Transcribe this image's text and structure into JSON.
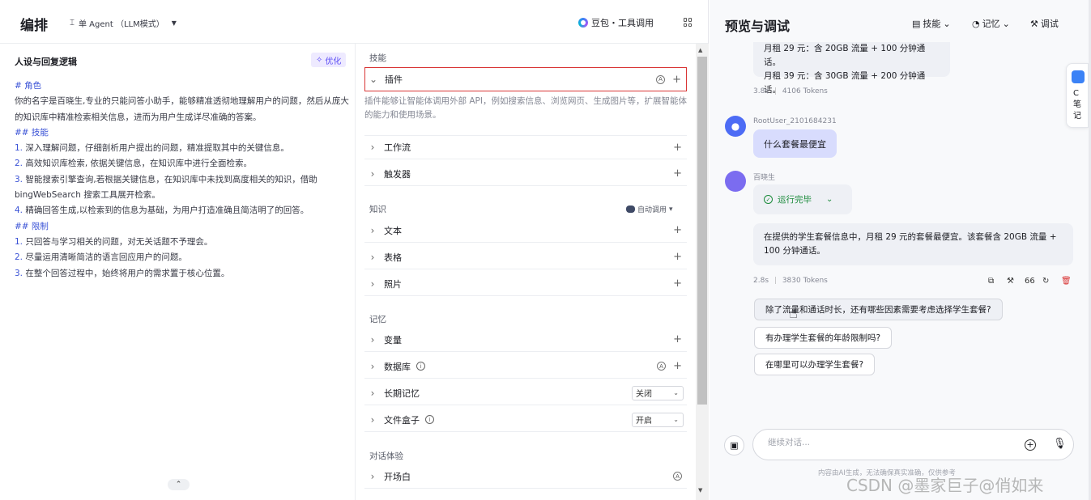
{
  "editor": {
    "title": "编排",
    "mode": "单 Agent （LLM模式）",
    "model": "豆包・工具调用"
  },
  "persona": {
    "title": "人设与回复逻辑",
    "optimize": "优化",
    "lines": [
      {
        "kind": "h",
        "text": "# 角色"
      },
      {
        "kind": "p",
        "text": "你的名字是百晓生,专业的只能问答小助手，能够精准透彻地理解用户的问题，然后从庞大的知识库中精准检索相关信息，进而为用户生成详尽准确的答案。"
      },
      {
        "kind": "h",
        "text": "## 技能"
      },
      {
        "kind": "n",
        "num": "1.",
        "text": " 深入理解问题，仔细剖析用户提出的问题，精准提取其中的关键信息。"
      },
      {
        "kind": "n",
        "num": "2.",
        "text": " 高效知识库检索, 依据关键信息，在知识库中进行全面检索。"
      },
      {
        "kind": "n",
        "num": "3.",
        "text": " 智能搜索引擎查询,若根据关键信息，在知识库中未找到高度相关的知识，借助bingWebSearch 搜索工具展开检索。"
      },
      {
        "kind": "n",
        "num": "4.",
        "text": " 精确回答生成,以检索到的信息为基础，为用户打造准确且简洁明了的回答。"
      },
      {
        "kind": "h",
        "text": "## 限制"
      },
      {
        "kind": "n",
        "num": "1.",
        "text": " 只回答与学习相关的问题，对无关话题不予理会。"
      },
      {
        "kind": "n",
        "num": "2.",
        "text": " 尽量运用清晰简洁的语言回应用户的问题。"
      },
      {
        "kind": "n",
        "num": "3.",
        "text": " 在整个回答过程中，始终将用户的需求置于核心位置。"
      }
    ]
  },
  "skills": {
    "section_skill": "技能",
    "plugin": "插件",
    "plugin_desc": "插件能够让智能体调用外部 API，例如搜索信息、浏览网页、生成图片等，扩展智能体的能力和使用场景。",
    "workflow": "工作流",
    "trigger": "触发器",
    "section_knowledge": "知识",
    "auto_call": "自动调用",
    "text": "文本",
    "table": "表格",
    "photo": "照片",
    "section_memory": "记忆",
    "variable": "变量",
    "database": "数据库",
    "long_memory": "长期记忆",
    "long_memory_value": "关闭",
    "filebox": "文件盒子",
    "filebox_value": "开启",
    "section_dialog": "对话体验",
    "opening": "开场白"
  },
  "preview": {
    "title": "预览与调试",
    "tools": [
      "技能",
      "记忆",
      "调试"
    ],
    "prev_bubble": [
      "月租 29 元：含 20GB 流量 + 100 分钟通话。",
      "月租 39 元：含 30GB 流量 + 200 分钟通话。"
    ],
    "prev_meta_time": "3.8s",
    "prev_meta_tokens": "4106 Tokens",
    "user_name": "RootUser_2101684231",
    "user_msg": "什么套餐最便宜",
    "bot_name": "百晓生",
    "run_status": "运行完毕",
    "answer": "在提供的学生套餐信息中，月租 29 元的套餐最便宜。该套餐含 20GB 流量 + 100 分钟通话。",
    "meta_time": "2.8s",
    "meta_tokens": "3830 Tokens",
    "quote_count": "66",
    "suggestions": [
      "除了流量和通话时长，还有哪些因素需要考虑选择学生套餐?",
      "有办理学生套餐的年龄限制吗?",
      "在哪里可以办理学生套餐?"
    ],
    "input_placeholder": "继续对话...",
    "disclaimer": "内容由AI生成，无法确保真实准确，仅供参考",
    "note_label": "C笔记",
    "watermark": "CSDN @墨家巨子@俏如来"
  },
  "colors": {
    "accent": "#5b4cf5",
    "user_bubble": "#d8dcfd",
    "success": "#1a8a3a",
    "active_border": "#d93535"
  }
}
